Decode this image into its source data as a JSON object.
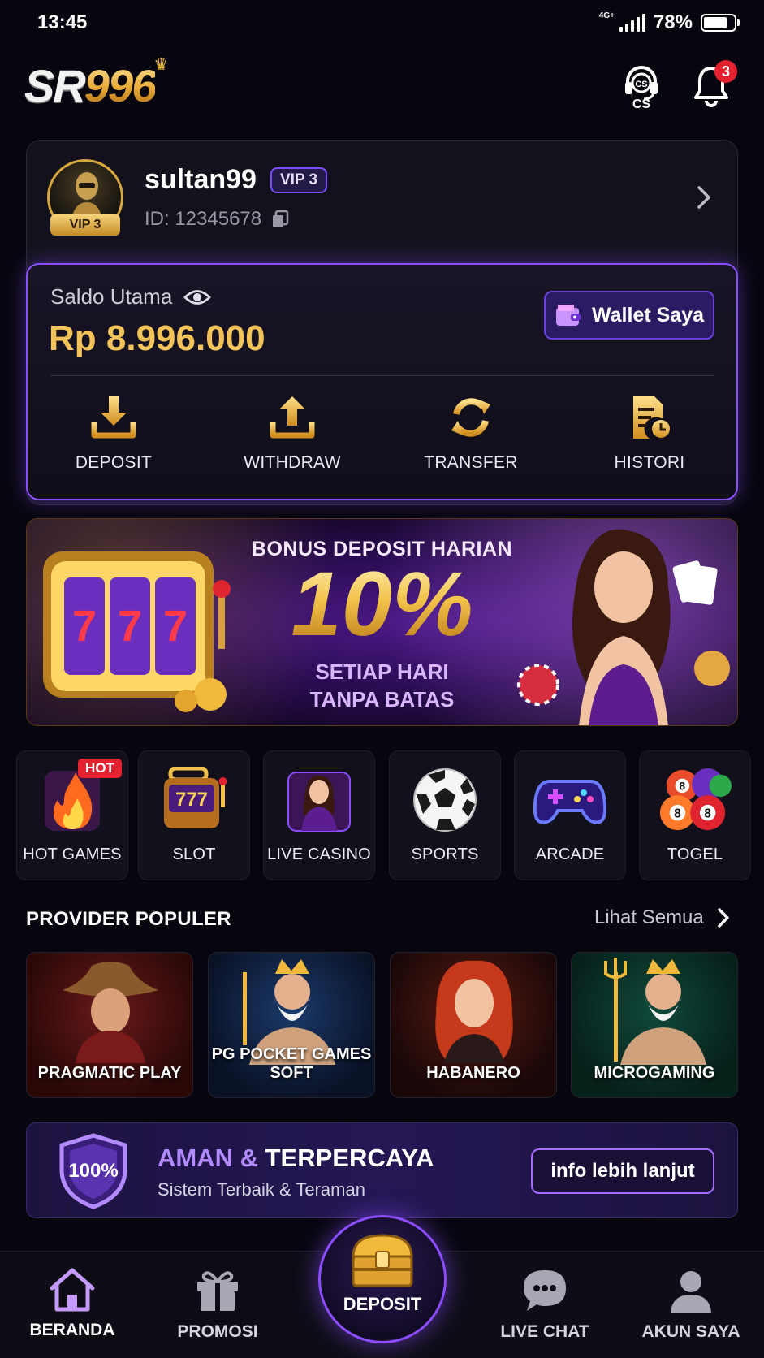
{
  "status_bar": {
    "time": "13:45",
    "network": "4G+",
    "battery": "78%",
    "battery_level": 0.78
  },
  "header": {
    "logo_main": "SR",
    "logo_num": "996",
    "cs_label": "CS",
    "notification_count": "3"
  },
  "profile": {
    "username": "sultan99",
    "vip_level": "VIP 3",
    "avatar_vip": "VIP 3",
    "user_id": "ID: 12345678"
  },
  "balance": {
    "label": "Saldo Utama",
    "value": "Rp 8.996.000",
    "wallet_button": "Wallet Saya",
    "actions": [
      "DEPOSIT",
      "WITHDRAW",
      "TRANSFER",
      "HISTORI"
    ]
  },
  "banner": {
    "line1": "BONUS DEPOSIT HARIAN",
    "line2": "10%",
    "line3": "SETIAP HARI",
    "line4": "TANPA BATAS"
  },
  "categories": {
    "items": [
      "HOT GAMES",
      "SLOT",
      "LIVE CASINO",
      "SPORTS",
      "ARCADE",
      "TOGEL"
    ],
    "hot_badge": "HOT",
    "slot_digits": "777",
    "togel_balls": [
      "8",
      "8",
      "8"
    ]
  },
  "providers": {
    "title": "PROVIDER POPULER",
    "see_all": "Lihat Semua",
    "items": [
      {
        "name": "PRAGMATIC PLAY"
      },
      {
        "name": "PG POCKET GAMES SOFT"
      },
      {
        "name": "HABANERO"
      },
      {
        "name": "MICROGAMING"
      }
    ]
  },
  "trust": {
    "badge": "100%",
    "title_a": "AMAN",
    "title_amp": " & ",
    "title_b": "TERPERCAYA",
    "subtitle": "Sistem Terbaik & Teraman",
    "button": "info lebih lanjut"
  },
  "bottom_nav": {
    "home": "BERANDA",
    "promo": "PROMOSI",
    "deposit": "DEPOSIT",
    "chat": "LIVE CHAT",
    "account": "AKUN SAYA"
  },
  "colors": {
    "accent": "#8a4dff",
    "gold": "#f5c458",
    "badge_red": "#e3212f",
    "background": "#07060e"
  }
}
